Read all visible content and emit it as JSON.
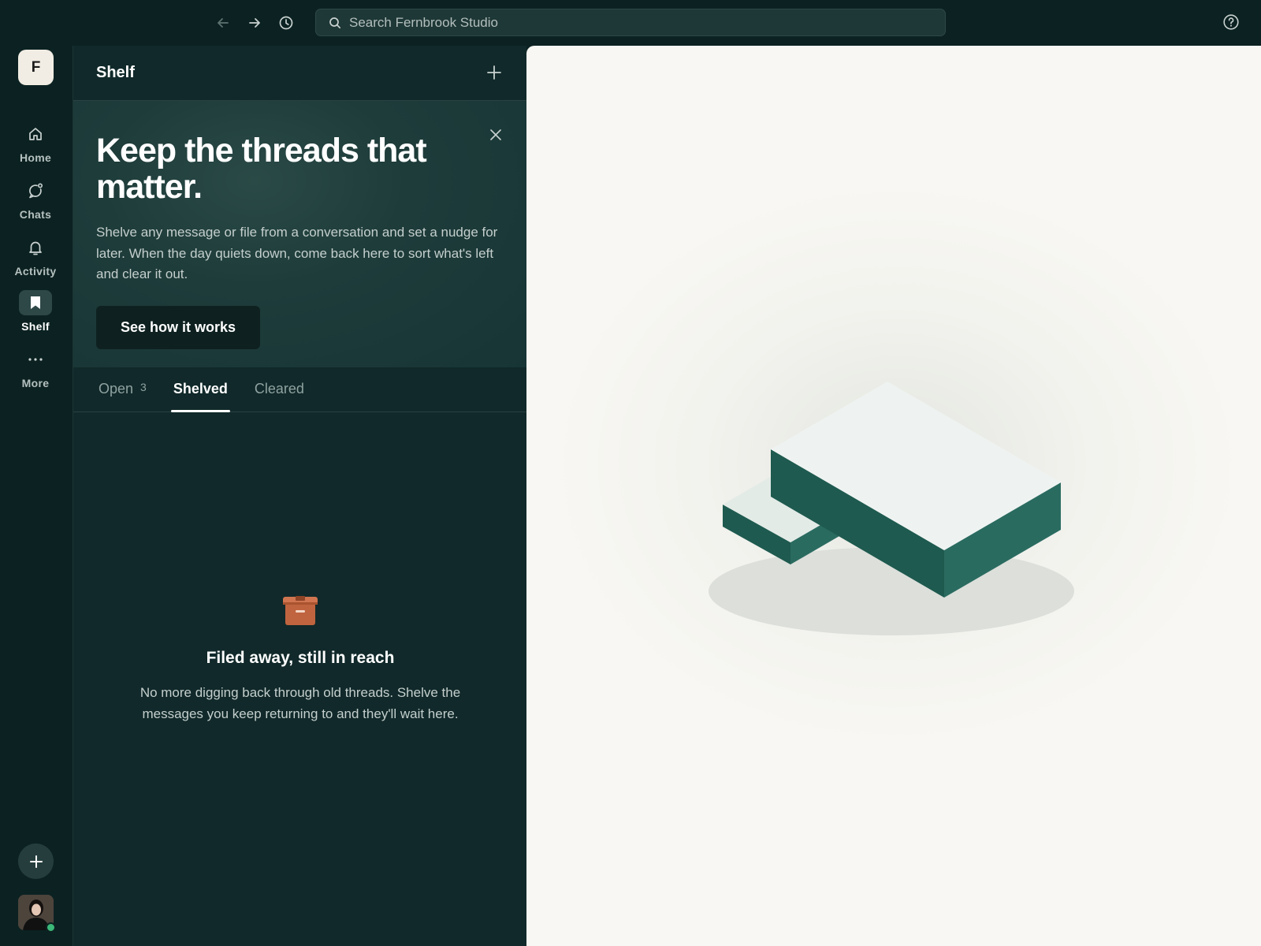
{
  "topbar": {
    "search_placeholder": "Search Fernbrook Studio"
  },
  "rail": {
    "workspace_initial": "F",
    "items": [
      {
        "label": "Home",
        "icon": "home-icon"
      },
      {
        "label": "Chats",
        "icon": "chat-icon"
      },
      {
        "label": "Activity",
        "icon": "bell-icon"
      },
      {
        "label": "Shelf",
        "icon": "bookmark-icon",
        "active": true
      },
      {
        "label": "More",
        "icon": "more-icon"
      }
    ]
  },
  "panel": {
    "title": "Shelf",
    "promo": {
      "heading": "Keep the threads that matter.",
      "body": "Shelve any message or file from a conversation and set a nudge for later. When the day quiets down, come back here to sort what's left and clear it out.",
      "button": "See how it works"
    },
    "tabs": [
      {
        "label": "Open",
        "count": "3"
      },
      {
        "label": "Shelved",
        "active": true
      },
      {
        "label": "Cleared"
      }
    ],
    "empty": {
      "icon": "archive-box-icon",
      "title": "Filed away, still in reach",
      "body": "No more digging back through old threads. Shelve the messages you keep returning to and they'll wait here."
    }
  },
  "colors": {
    "app_bg": "#0c2222",
    "panel_bg": "#11292a",
    "detail_bg": "#f8f7f3",
    "accent_teal": "#1e5a4f",
    "archive_icon": "#c0643f",
    "presence": "#3cb878"
  }
}
